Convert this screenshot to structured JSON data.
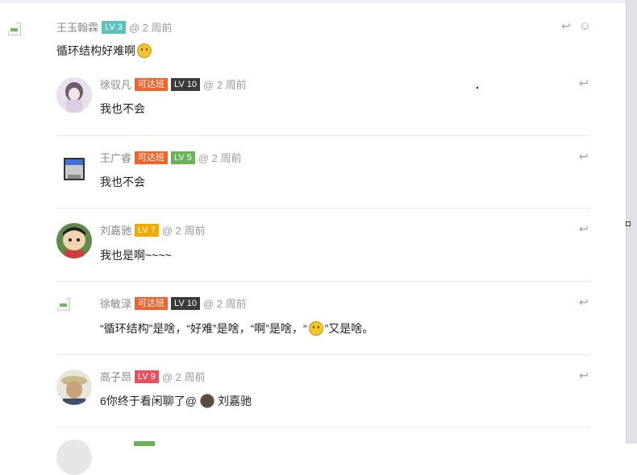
{
  "colors": {
    "lv_teal": "#5bc0be",
    "kedaban_orange": "#f0642a",
    "lv_dark": "#3b3b3b",
    "lv_green": "#6bb35a",
    "lv_yellow": "#f2a900",
    "lv_red": "#e8505b"
  },
  "main": {
    "author": "王玉翰霖",
    "level": "LV 3",
    "time": "@ 2 周前",
    "text": "循环结构好难啊",
    "actions": [
      "reply-icon",
      "smile-icon"
    ]
  },
  "replies": [
    {
      "author": "徐驭凡",
      "class_badge": "可达班",
      "level": "LV 10",
      "time": "@ 2 周前",
      "text": "我也不会"
    },
    {
      "author": "王广睿",
      "class_badge": "可达班",
      "level": "LV 5",
      "time": "@ 2 周前",
      "text": "我也不会"
    },
    {
      "author": "刘嘉驰",
      "level": "LV 7",
      "time": "@ 2 周前",
      "text": "我也是啊~~~~"
    },
    {
      "author": "徐敏渌",
      "class_badge": "可达班",
      "level": "LV 10",
      "time": "@ 2 周前",
      "text_parts": [
        "“循环结构”是啥，“好难”是啥，“啊”是啥，“",
        "”又是啥。"
      ]
    },
    {
      "author": "高子昂",
      "level": "LV 9",
      "time": "@ 2 周前",
      "text_prefix": "6你终于看闲聊了@",
      "mention": "刘嘉驰"
    }
  ]
}
